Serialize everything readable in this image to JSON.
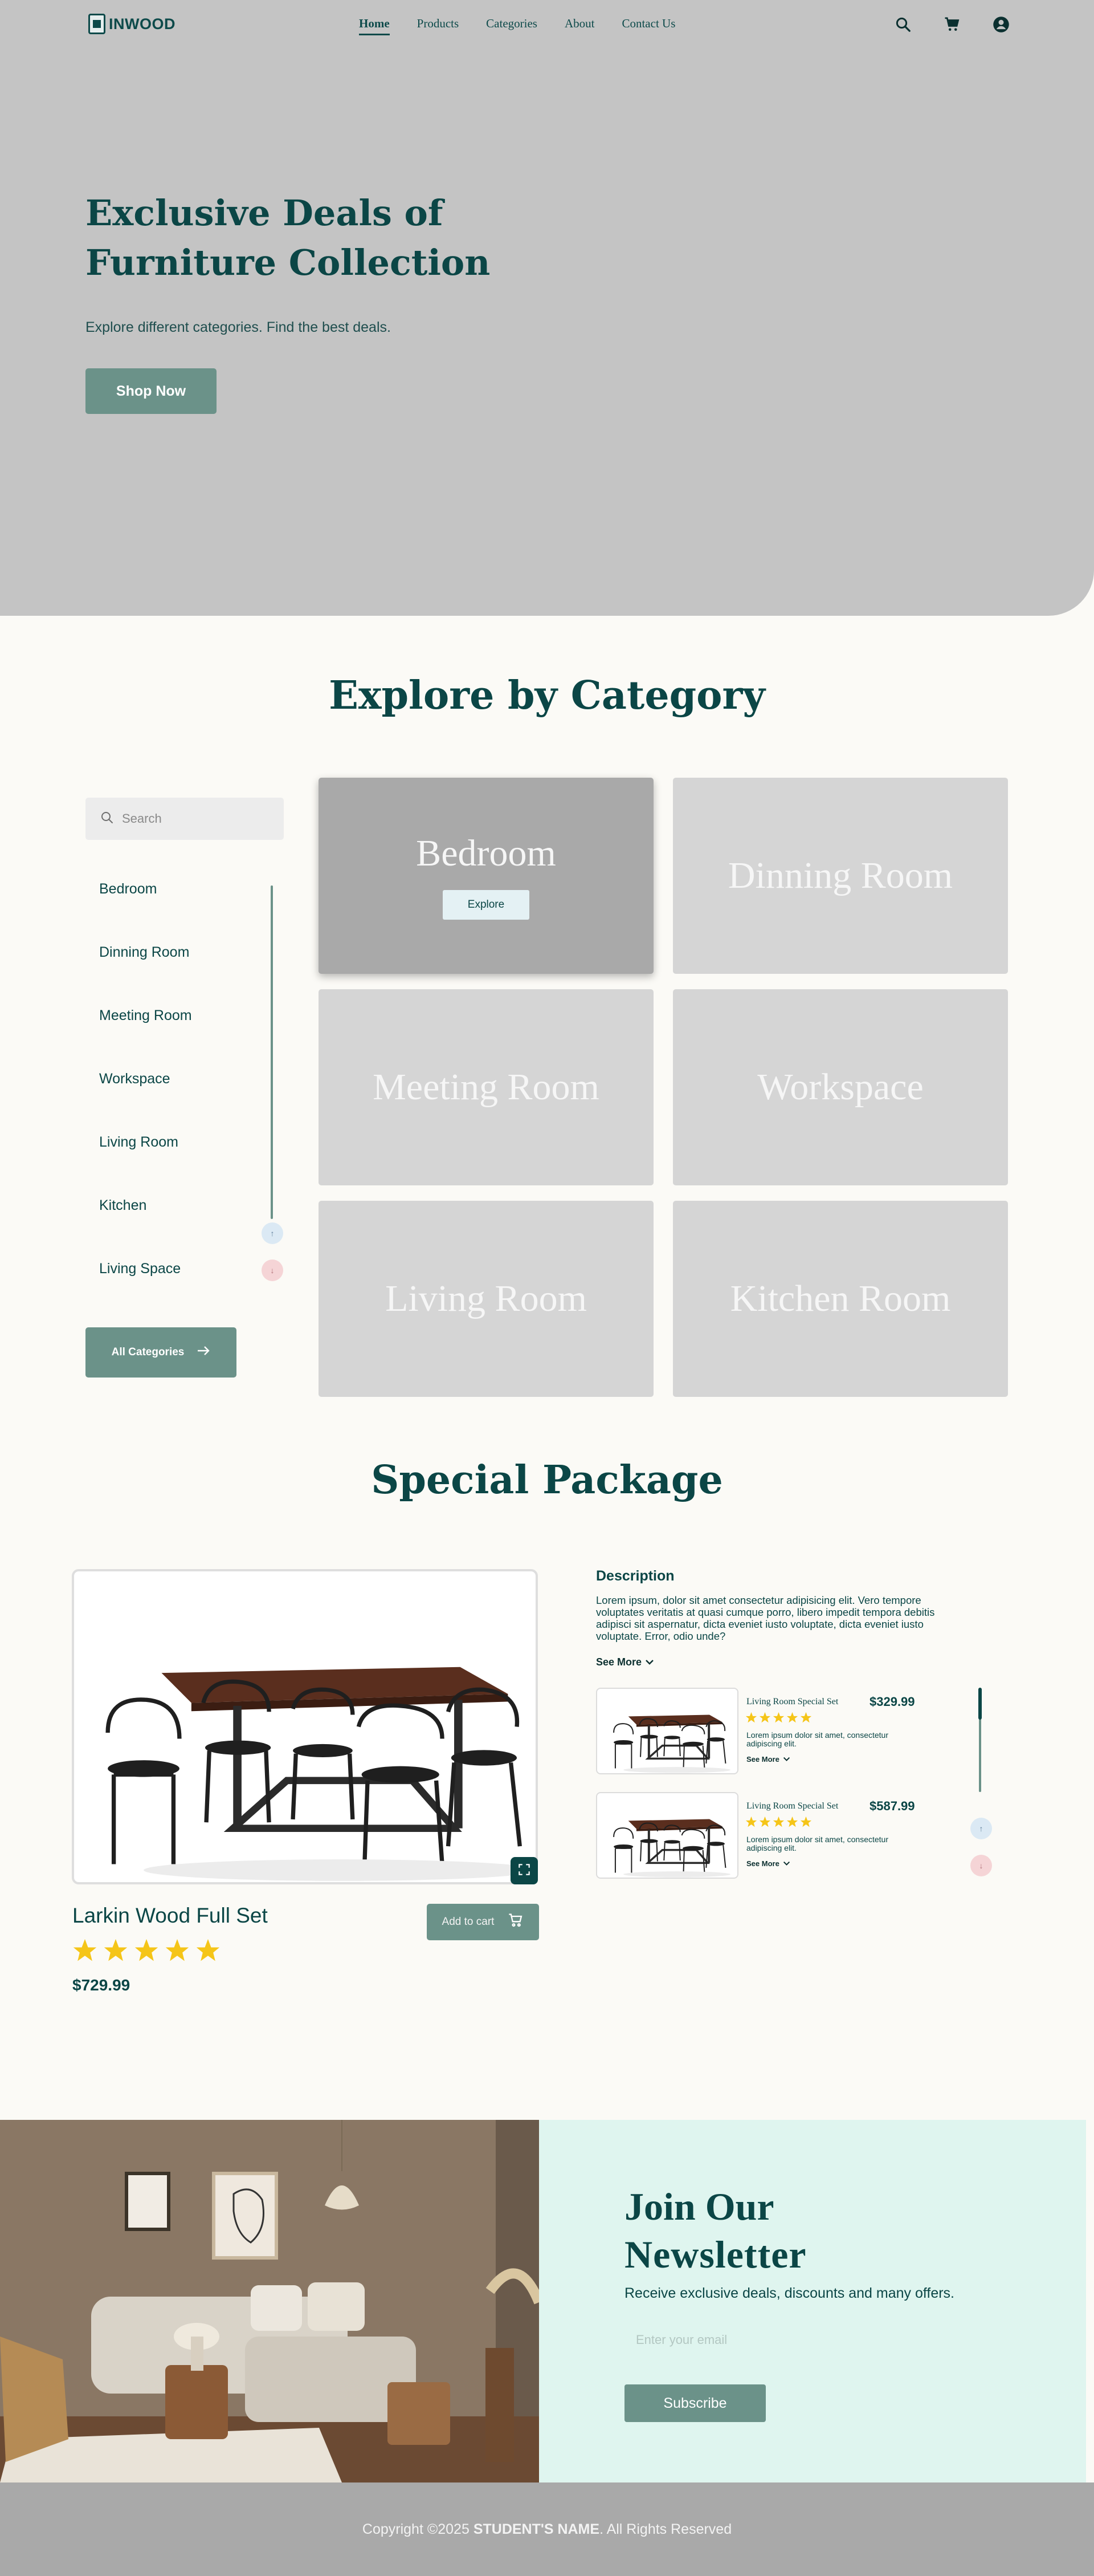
{
  "header": {
    "logo_text": "INWOOD",
    "nav": [
      "Home",
      "Products",
      "Categories",
      "About",
      "Contact Us"
    ],
    "active_nav": "Home",
    "icons": [
      "search-icon",
      "cart-icon",
      "account-icon"
    ]
  },
  "hero": {
    "title_line1": "Exclusive Deals of",
    "title_line2": "Furniture Collection",
    "subtitle": "Explore different categories. Find the best deals.",
    "cta": "Shop Now"
  },
  "category": {
    "title": "Explore by Category",
    "search_placeholder": "Search",
    "list": [
      "Bedroom",
      "Dinning Room",
      "Meeting Room",
      "Workspace",
      "Living Room",
      "Kitchen",
      "Living Space"
    ],
    "all_button": "All Categories",
    "tiles": [
      "Bedroom",
      "Dinning Room",
      "Meeting Room",
      "Workspace",
      "Living Room",
      "Kitchen Room"
    ],
    "active_tile": "Bedroom",
    "explore_label": "Explore"
  },
  "package": {
    "title": "Special Package",
    "main": {
      "name": "Larkin Wood Full Set",
      "rating": 5,
      "price": "$729.99",
      "add_to_cart": "Add to cart"
    },
    "description_title": "Description",
    "description": "Lorem ipsum, dolor sit amet consectetur adipisicing elit. Vero tempore voluptates veritatis at quasi cumque porro, libero impedit tempora debitis adipisci sit aspernatur, dicta eveniet iusto voluptate, dicta eveniet iusto voluptate. Error, odio unde?",
    "see_more": "See More",
    "items": [
      {
        "name": "Living Room Special Set",
        "price": "$329.99",
        "rating": 5,
        "desc": "Lorem ipsum dolor sit amet, consectetur adipiscing elit.",
        "see_more": "See More"
      },
      {
        "name": "Living Room Special Set",
        "price": "$587.99",
        "rating": 5,
        "desc": "Lorem ipsum dolor sit amet, consectetur adipiscing elit.",
        "see_more": "See More"
      }
    ]
  },
  "newsletter": {
    "title_line1": "Join Our",
    "title_line2": "Newsletter",
    "subtitle": "Receive exclusive deals, discounts and many offers.",
    "email_placeholder": "Enter your email",
    "subscribe": "Subscribe"
  },
  "footer": {
    "prefix": "Copyright ©2025",
    "name": "STUDENT'S NAME",
    "suffix": ". All Rights Reserved"
  },
  "colors": {
    "primary": "#0b4646",
    "accent": "#6b9289",
    "hero_bg": "#c4c4c4",
    "newsletter_bg": "#dff5ef",
    "star": "#f5c518"
  }
}
